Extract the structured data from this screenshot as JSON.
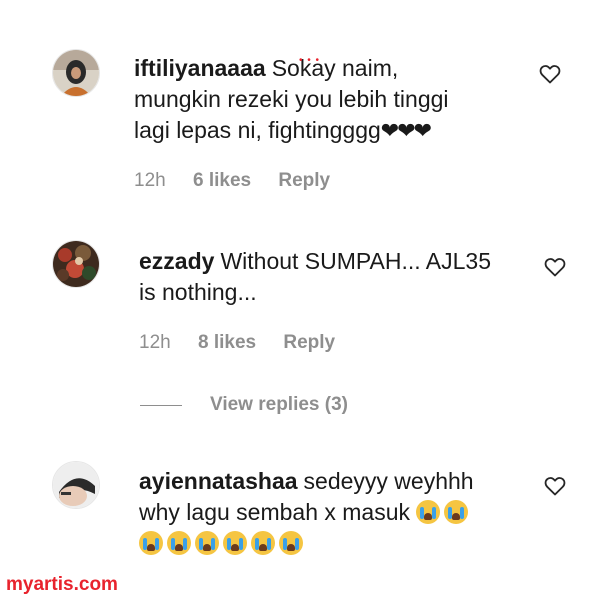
{
  "comments": [
    {
      "username": "iftiliyanaaaa",
      "text_lines": [
        "Sokay naim,",
        "mungkin rezeki you lebih tinggi",
        "lagi lepas ni, fightingggg"
      ],
      "hearts": "❤❤❤",
      "time": "12h",
      "likes": "6 likes",
      "reply": "Reply",
      "avatar_icon": "profile-photo-woman-hijab"
    },
    {
      "username": "ezzady",
      "text_lines": [
        "Without SUMPAH... AJL35",
        "is nothing..."
      ],
      "time": "12h",
      "likes": "8 likes",
      "reply": "Reply",
      "view_replies": "View replies (3)",
      "avatar_icon": "profile-photo-flowers"
    },
    {
      "username": "ayiennatashaa",
      "text_lines": [
        "sedeyyy weyhhh",
        "why lagu sembah x masuk"
      ],
      "avatar_icon": "profile-photo-person"
    }
  ],
  "icons": {
    "like": "heart-outline-icon",
    "crying": "loudly-crying-face-emoji"
  },
  "watermark": "myartis.com",
  "colors": {
    "meta": "#8e8e8e",
    "watermark": "#e8232d",
    "emoji": "#f5c542"
  }
}
